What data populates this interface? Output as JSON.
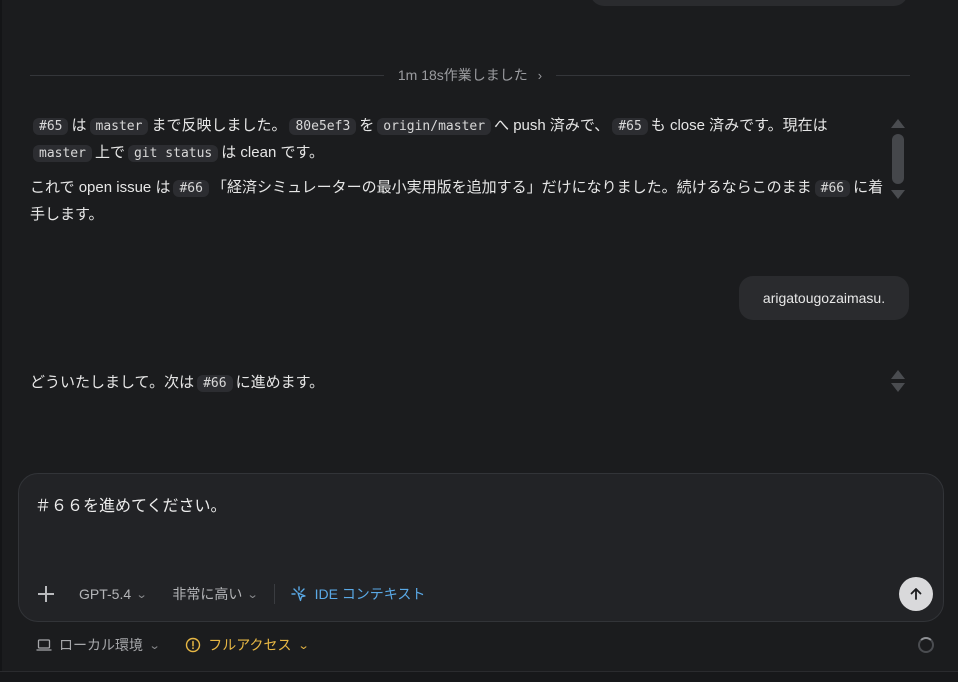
{
  "divider": {
    "label": "1m 18s作業しました"
  },
  "assistant_message_1": {
    "p1": {
      "issue": "#65",
      "t1": "は",
      "branch": "master",
      "t2": "まで反映しました。",
      "commit": "80e5ef3",
      "t3": "を",
      "remote": "origin/master",
      "t4": "へ push 済みで、",
      "issue2": "#65",
      "t5": "も close 済みです。現在は",
      "branch2": "master",
      "t6": "上で",
      "cmd": "git status",
      "t7": "は clean です。"
    },
    "p2": {
      "t1": "これで open issue は",
      "issue": "#66",
      "t2": "「経済シミュレーターの最小実用版を追加する」だけになりました。続けるならこのまま",
      "issue2": "#66",
      "t3": "に着手します。"
    }
  },
  "user_message": {
    "text": "arigatougozaimasu."
  },
  "assistant_message_2": {
    "t1": "どういたしまして。次は",
    "issue": "#66",
    "t2": "に進めます。"
  },
  "composer": {
    "value": "＃６６を進めてください。",
    "model": "GPT-5.4",
    "reasoning": "非常に高い",
    "ide_context": "IDE コンテキスト"
  },
  "status": {
    "environment": "ローカル環境",
    "access": "フルアクセス"
  },
  "colors": {
    "background": "#1b1c1e",
    "accent_blue": "#5aa9e6",
    "warning_yellow": "#e7b744"
  },
  "icons": [
    "chevron-right-icon",
    "plus-icon",
    "chevron-down-icon",
    "sparkle-icon",
    "arrow-up-icon",
    "laptop-icon",
    "warning-circle-icon",
    "spinner-icon"
  ]
}
